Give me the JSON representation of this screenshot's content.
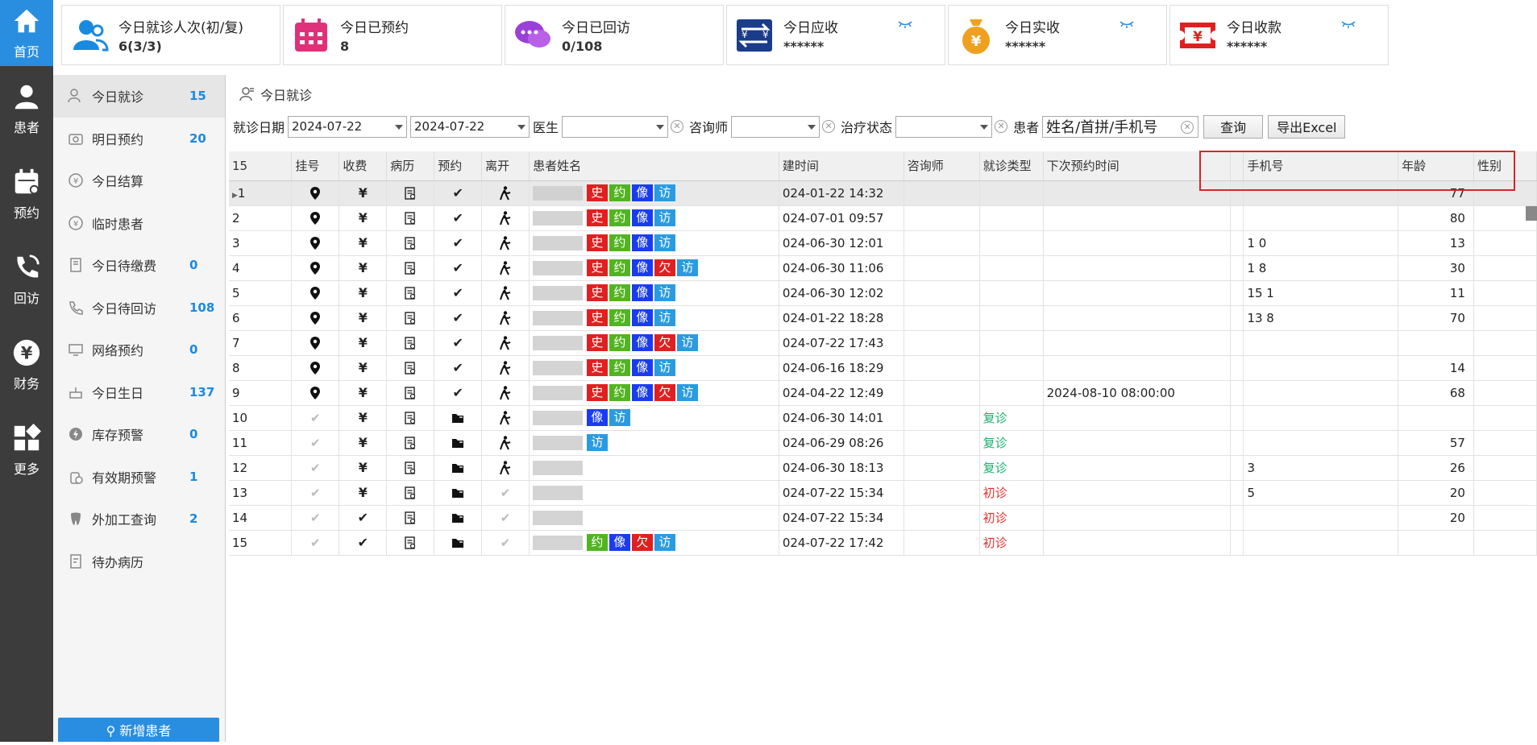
{
  "nav": [
    {
      "label": "首页",
      "icon": "home-icon",
      "active": true
    },
    {
      "label": "患者",
      "icon": "user-icon"
    },
    {
      "label": "预约",
      "icon": "calendar-icon"
    },
    {
      "label": "回访",
      "icon": "phone-icon"
    },
    {
      "label": "财务",
      "icon": "yen-icon"
    },
    {
      "label": "更多",
      "icon": "grid-icon"
    }
  ],
  "stats": [
    {
      "label": "今日就诊人次(初/复)",
      "value": "6(3/3)",
      "icon": "patients-icon",
      "color": "#1a8ae0"
    },
    {
      "label": "今日已预约",
      "value": "8",
      "icon": "calendar-icon",
      "color": "#e0307a"
    },
    {
      "label": "今日已回访",
      "value": "0/108",
      "icon": "chat-icon",
      "color": "#9a40d8"
    },
    {
      "label": "今日应收",
      "value": "******",
      "icon": "exchange-icon",
      "color": "#1a3c8a",
      "hidden": true
    },
    {
      "label": "今日实收",
      "value": "******",
      "icon": "moneybag-icon",
      "color": "#f0a020",
      "hidden": true
    },
    {
      "label": "今日收款",
      "value": "******",
      "icon": "ticket-icon",
      "color": "#e02020",
      "hidden": true
    }
  ],
  "side": [
    {
      "label": "今日就诊",
      "count": "15",
      "icon": "visit-icon",
      "active": true
    },
    {
      "label": "明日预约",
      "count": "20",
      "icon": "camera-icon"
    },
    {
      "label": "今日结算",
      "count": "",
      "icon": "yen-circle-icon"
    },
    {
      "label": "临时患者",
      "count": "",
      "icon": "yen-circle-icon"
    },
    {
      "label": "今日待缴费",
      "count": "0",
      "icon": "bill-icon"
    },
    {
      "label": "今日待回访",
      "count": "108",
      "icon": "phone-icon"
    },
    {
      "label": "网络预约",
      "count": "0",
      "icon": "monitor-icon"
    },
    {
      "label": "今日生日",
      "count": "137",
      "icon": "cake-icon"
    },
    {
      "label": "库存预警",
      "count": "0",
      "icon": "bolt-icon"
    },
    {
      "label": "有效期预警",
      "count": "1",
      "icon": "clock-bottle-icon"
    },
    {
      "label": "外加工查询",
      "count": "2",
      "icon": "tooth-icon"
    },
    {
      "label": "待办病历",
      "count": "",
      "icon": "record-icon"
    }
  ],
  "new_patient": "新增患者",
  "crumb": "今日就诊",
  "filters": {
    "date_label": "就诊日期",
    "date_from": "2024-07-22",
    "date_to": "2024-07-22",
    "doctor_label": "医生",
    "consultant_label": "咨询师",
    "status_label": "治疗状态",
    "patient_label": "患者",
    "patient_placeholder": "姓名/首拼/手机号",
    "search_button": "查询",
    "export_button": "导出Excel"
  },
  "table": {
    "count": "15",
    "headers": [
      "挂号",
      "收费",
      "病历",
      "预约",
      "离开",
      "患者姓名",
      "建时间",
      "咨询师",
      "就诊类型",
      "下次预约时间",
      "",
      "手机号",
      "年龄",
      "性别"
    ],
    "rows": [
      {
        "no": "1",
        "reg": true,
        "pay": "yen",
        "tags": [
          "史",
          "约",
          "像",
          "访"
        ],
        "created": "024-01-22 14:32",
        "type": "",
        "next": "",
        "phone": "",
        "age": "77"
      },
      {
        "no": "2",
        "reg": true,
        "pay": "yen",
        "tags": [
          "史",
          "约",
          "像",
          "访"
        ],
        "created": "024-07-01 09:57",
        "type": "",
        "next": "",
        "phone": "",
        "age": "80"
      },
      {
        "no": "3",
        "reg": true,
        "pay": "yen",
        "tags": [
          "史",
          "约",
          "像",
          "访"
        ],
        "created": "024-06-30 12:01",
        "type": "",
        "next": "",
        "phone": "1 0",
        "age": "13"
      },
      {
        "no": "4",
        "reg": true,
        "pay": "yen",
        "tags": [
          "史",
          "约",
          "像",
          "欠",
          "访"
        ],
        "created": "024-06-30 11:06",
        "type": "",
        "next": "",
        "phone": "1 8",
        "age": "30"
      },
      {
        "no": "5",
        "reg": true,
        "pay": "yen",
        "tags": [
          "史",
          "约",
          "像",
          "访"
        ],
        "created": "024-06-30 12:02",
        "type": "",
        "next": "",
        "phone": "15 1",
        "age": "11"
      },
      {
        "no": "6",
        "reg": true,
        "pay": "yen",
        "tags": [
          "史",
          "约",
          "像",
          "访"
        ],
        "created": "024-01-22 18:28",
        "type": "",
        "next": "",
        "phone": "13 8",
        "age": "70"
      },
      {
        "no": "7",
        "reg": true,
        "pay": "yen",
        "tags": [
          "史",
          "约",
          "像",
          "欠",
          "访"
        ],
        "created": "024-07-22 17:43",
        "type": "",
        "next": "",
        "phone": "",
        "age": ""
      },
      {
        "no": "8",
        "reg": true,
        "pay": "yen",
        "tags": [
          "史",
          "约",
          "像",
          "访"
        ],
        "created": "024-06-16 18:29",
        "type": "",
        "next": "",
        "phone": "",
        "age": "14"
      },
      {
        "no": "9",
        "reg": true,
        "pay": "yen",
        "tags": [
          "史",
          "约",
          "像",
          "欠",
          "访"
        ],
        "created": "024-04-22 12:49",
        "type": "",
        "next": "2024-08-10 08:00:00",
        "phone": "",
        "age": "68"
      },
      {
        "no": "10",
        "reg": false,
        "pay": "yen",
        "tags": [
          "像",
          "访"
        ],
        "created": "024-06-30 14:01",
        "type": "复诊",
        "next": "",
        "phone": "",
        "age": ""
      },
      {
        "no": "11",
        "reg": false,
        "pay": "yen",
        "tags": [
          "访"
        ],
        "created": "024-06-29 08:26",
        "type": "复诊",
        "next": "",
        "phone": "",
        "age": "57"
      },
      {
        "no": "12",
        "reg": false,
        "pay": "yen",
        "tags": [],
        "created": "024-06-30 18:13",
        "type": "复诊",
        "next": "",
        "phone": "3",
        "age": "26"
      },
      {
        "no": "13",
        "reg": false,
        "pay": "yen",
        "tags": [],
        "created": "024-07-22 15:34",
        "type": "初诊",
        "next": "",
        "phone": "5",
        "age": "20"
      },
      {
        "no": "14",
        "reg": false,
        "pay": "check",
        "tags": [],
        "created": "024-07-22 15:34",
        "type": "初诊",
        "next": "",
        "phone": "",
        "age": "20"
      },
      {
        "no": "15",
        "reg": false,
        "pay": "check",
        "tags": [
          "约",
          "像",
          "欠",
          "访"
        ],
        "created": "024-07-22 17:42",
        "type": "初诊",
        "next": "",
        "phone": "",
        "age": ""
      }
    ]
  }
}
